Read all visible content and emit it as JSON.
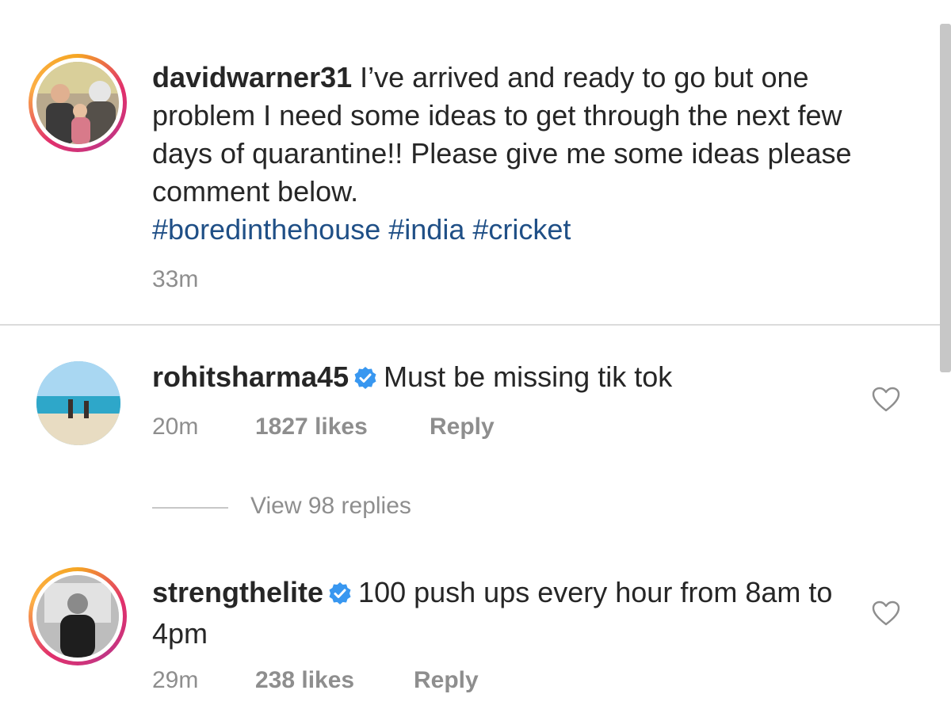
{
  "post": {
    "username": "davidwarner31",
    "caption": "I’ve arrived and ready to go but one problem I need some ideas to get through the next few days of quarantine!! Please give me some ideas please comment below.",
    "hashtags": [
      "#boredinthehouse",
      "#india",
      "#cricket"
    ],
    "time": "33m"
  },
  "comments": [
    {
      "username": "rohitsharma45",
      "verified": true,
      "text": "Must be missing tik tok",
      "time": "20m",
      "likes": "1827 likes",
      "reply_label": "Reply",
      "view_replies": "View 98 replies"
    },
    {
      "username": "strengthelite",
      "verified": true,
      "text": "100 push ups every hour from 8am to 4pm",
      "time": "29m",
      "likes": "238 likes",
      "reply_label": "Reply"
    }
  ],
  "colors": {
    "hashtag": "#1f4f86",
    "verified_badge": "#3897f0",
    "meta_text": "#8e8e8e"
  }
}
